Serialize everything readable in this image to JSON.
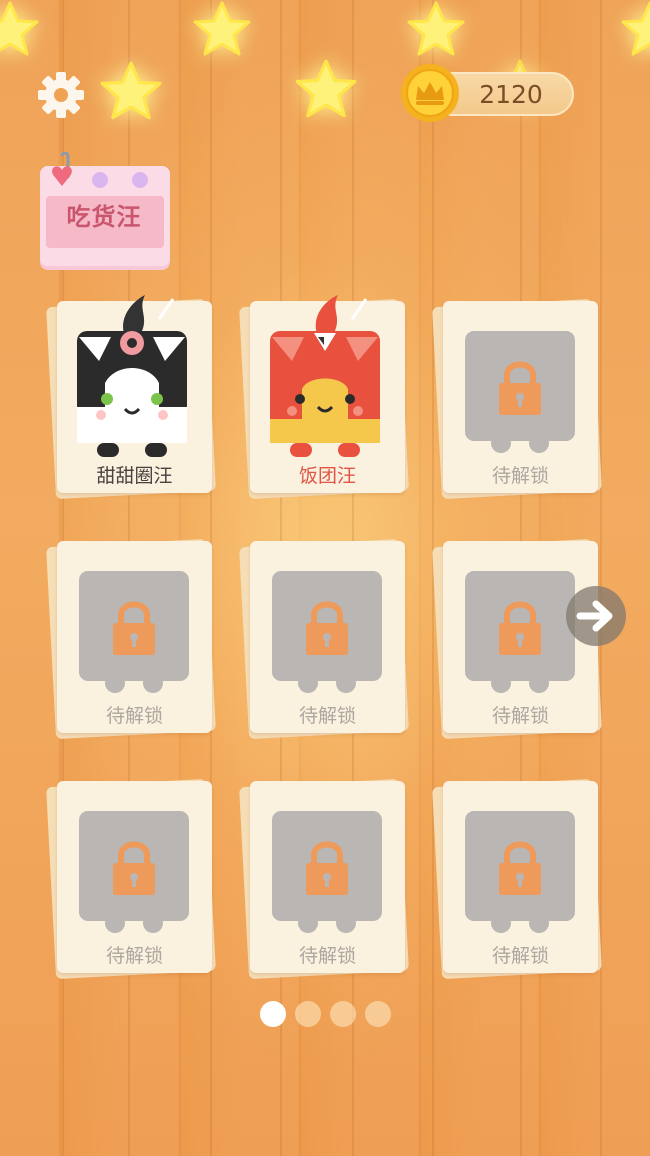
{
  "header": {
    "coins": "2120",
    "event_label": "吃货汪"
  },
  "characters": [
    {
      "label": "甜甜圈汪",
      "state": "unlocked"
    },
    {
      "label": "饭团汪",
      "state": "unlocked"
    },
    {
      "label": "待解锁",
      "state": "locked"
    },
    {
      "label": "待解锁",
      "state": "locked"
    },
    {
      "label": "待解锁",
      "state": "locked"
    },
    {
      "label": "待解锁",
      "state": "locked"
    },
    {
      "label": "待解锁",
      "state": "locked"
    },
    {
      "label": "待解锁",
      "state": "locked"
    },
    {
      "label": "待解锁",
      "state": "locked"
    }
  ],
  "pagination": {
    "total": 4,
    "current": 1
  },
  "colors": {
    "background": "#F0A253",
    "card": "#FBF1DF",
    "locked_tile": "#B9B6B3",
    "lock_icon": "#EE9A5B",
    "coin_text": "#7B4D26",
    "name_highlight": "#E05545"
  },
  "icons": {
    "settings": "gear-icon",
    "currency": "crown-coin-icon",
    "next": "arrow-right-icon",
    "locked": "padlock-icon"
  }
}
